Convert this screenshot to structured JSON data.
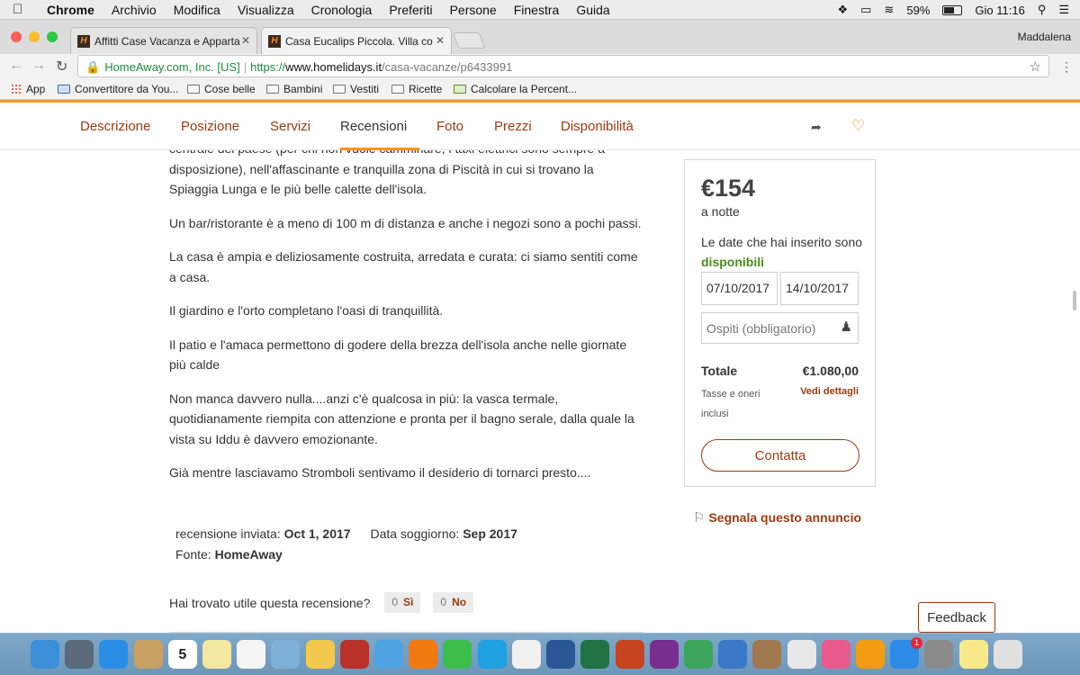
{
  "menubar": {
    "apple": "",
    "items": [
      "Chrome",
      "Archivio",
      "Modifica",
      "Visualizza",
      "Cronologia",
      "Preferiti",
      "Persone",
      "Finestra",
      "Guida"
    ],
    "battery": "59%",
    "clock": "Gio 11:16"
  },
  "browser": {
    "tabs": [
      {
        "title": "Affitti Case Vacanza e Apparta",
        "favicon": "H"
      },
      {
        "title": "Casa Eucalips Piccola. Villa co",
        "favicon": "H"
      }
    ],
    "profile": "Maddalena",
    "address": {
      "org": "HomeAway.com, Inc. [US]",
      "scheme": "https://",
      "host": "www.homelidays.it",
      "path": "/casa-vacanze/p6433991"
    },
    "bookmarks": [
      "App",
      "Convertitore da You...",
      "Cose belle",
      "Bambini",
      "Vestiti",
      "Ricette",
      "Calcolare la Percent..."
    ]
  },
  "nav": {
    "items": [
      "Descrizione",
      "Posizione",
      "Servizi",
      "Recensioni",
      "Foto",
      "Prezzi",
      "Disponibilità"
    ]
  },
  "review": {
    "paragraphs": [
      "centrale del paese (per chi non vuole camminare, i taxi elettrici sono sempre a disposizione), nell'affascinante e tranquilla zona di Piscità in cui si trovano la Spiaggia Lunga e le più belle calette dell'isola.",
      "Un bar/ristorante è a meno di 100 m di distanza e anche i negozi sono a pochi passi.",
      "La casa è ampia e deliziosamente costruita, arredata e curata: ci siamo sentiti come a casa.",
      "Il giardino e l'orto completano l'oasi di tranquillità.",
      "Il patio e l'amaca permettono di godere della brezza dell'isola anche nelle giornate più calde",
      "Non manca davvero nulla....anzi c'è qualcosa in più: la vasca termale, quotidianamente riempita con attenzione e pronta per il bagno serale, dalla quale la vista su Iddu è davvero emozionante.",
      "Già mentre lasciavamo Stromboli sentivamo il desiderio di tornarci presto...."
    ],
    "sent_label": "recensione inviata:",
    "sent_value": "Oct 1, 2017",
    "stay_label": "Data soggiorno:",
    "stay_value": "Sep 2017",
    "source_label": "Fonte:",
    "source_value": "HomeAway",
    "helpful_question": "Hai trovato utile questa recensione?",
    "yes_count": "0",
    "yes_label": "Sì",
    "no_count": "0",
    "no_label": "No"
  },
  "booking": {
    "price": "€154",
    "per_night": "a notte",
    "dates_text": "Le date che hai inserito sono",
    "available": "disponibili",
    "checkin": "07/10/2017",
    "checkout": "14/10/2017",
    "guests_placeholder": "Ospiti (obbligatorio)",
    "total_label": "Totale",
    "total_value": "€1.080,00",
    "tax_note": "Tasse e oneri inclusi",
    "details_link": "Vedi dettagli",
    "contact_button": "Contatta"
  },
  "report_link": "Segnala questo annuncio",
  "feedback_button": "Feedback",
  "colors": {
    "brand_orange": "#f7941d",
    "link_brown": "#9c3a12",
    "available_green": "#4b8b1e"
  },
  "dock": {
    "apps": [
      "finder-icon",
      "launchpad-icon",
      "safari-icon",
      "contacts-icon",
      "calendar-icon",
      "notes-icon",
      "reminders-icon",
      "preview-icon",
      "photos-icon",
      "photo-booth-icon",
      "messages-icon",
      "vlc-icon",
      "facetime-icon",
      "skype-icon",
      "textedit-icon",
      "word-icon",
      "excel-icon",
      "powerpoint-icon",
      "onenote-icon",
      "numbers-icon",
      "keynote-icon",
      "image-capture-icon",
      "chrome-icon",
      "itunes-icon",
      "ibooks-icon",
      "app-store-icon",
      "system-preferences-icon",
      "stickies-icon",
      "trash-icon"
    ],
    "calendar_day": "5",
    "appstore_badge": "1"
  }
}
